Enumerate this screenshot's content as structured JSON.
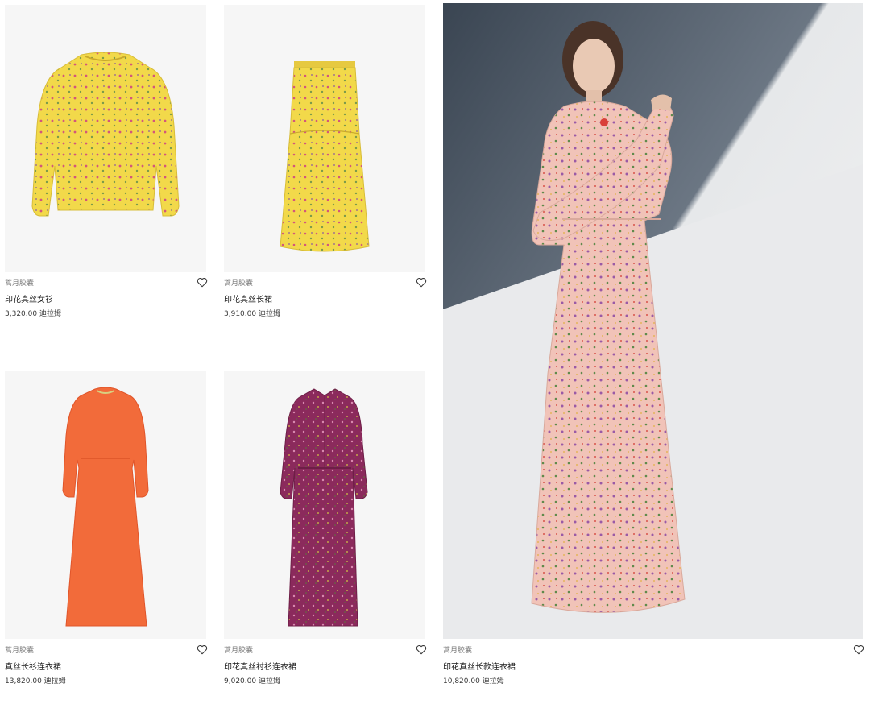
{
  "products": [
    {
      "brand": "蒿月胶囊",
      "name": "印花真丝女衫",
      "price": "3,320.00 迪拉姆",
      "icon": "heart-outline-icon"
    },
    {
      "brand": "蒿月胶囊",
      "name": "印花真丝长裙",
      "price": "3,910.00 迪拉姆",
      "icon": "heart-outline-icon"
    },
    {
      "brand": "蒿月胶囊",
      "name": "真丝长衫连衣裙",
      "price": "13,820.00 迪拉姆",
      "icon": "heart-outline-icon"
    },
    {
      "brand": "蒿月胶囊",
      "name": "印花真丝衬衫连衣裙",
      "price": "9,020.00 迪拉姆",
      "icon": "heart-outline-icon"
    },
    {
      "brand": "蒿月胶囊",
      "name": "印花真丝长款连衣裙",
      "price": "10,820.00 迪拉姆",
      "icon": "heart-outline-icon"
    }
  ],
  "colors": {
    "yellow_print": "#f2d94a",
    "orange_dress": "#f26b3a",
    "purple_print": "#8b2a5c",
    "pink_satin": "#f1c3b8",
    "card_bg": "#f6f6f6"
  }
}
